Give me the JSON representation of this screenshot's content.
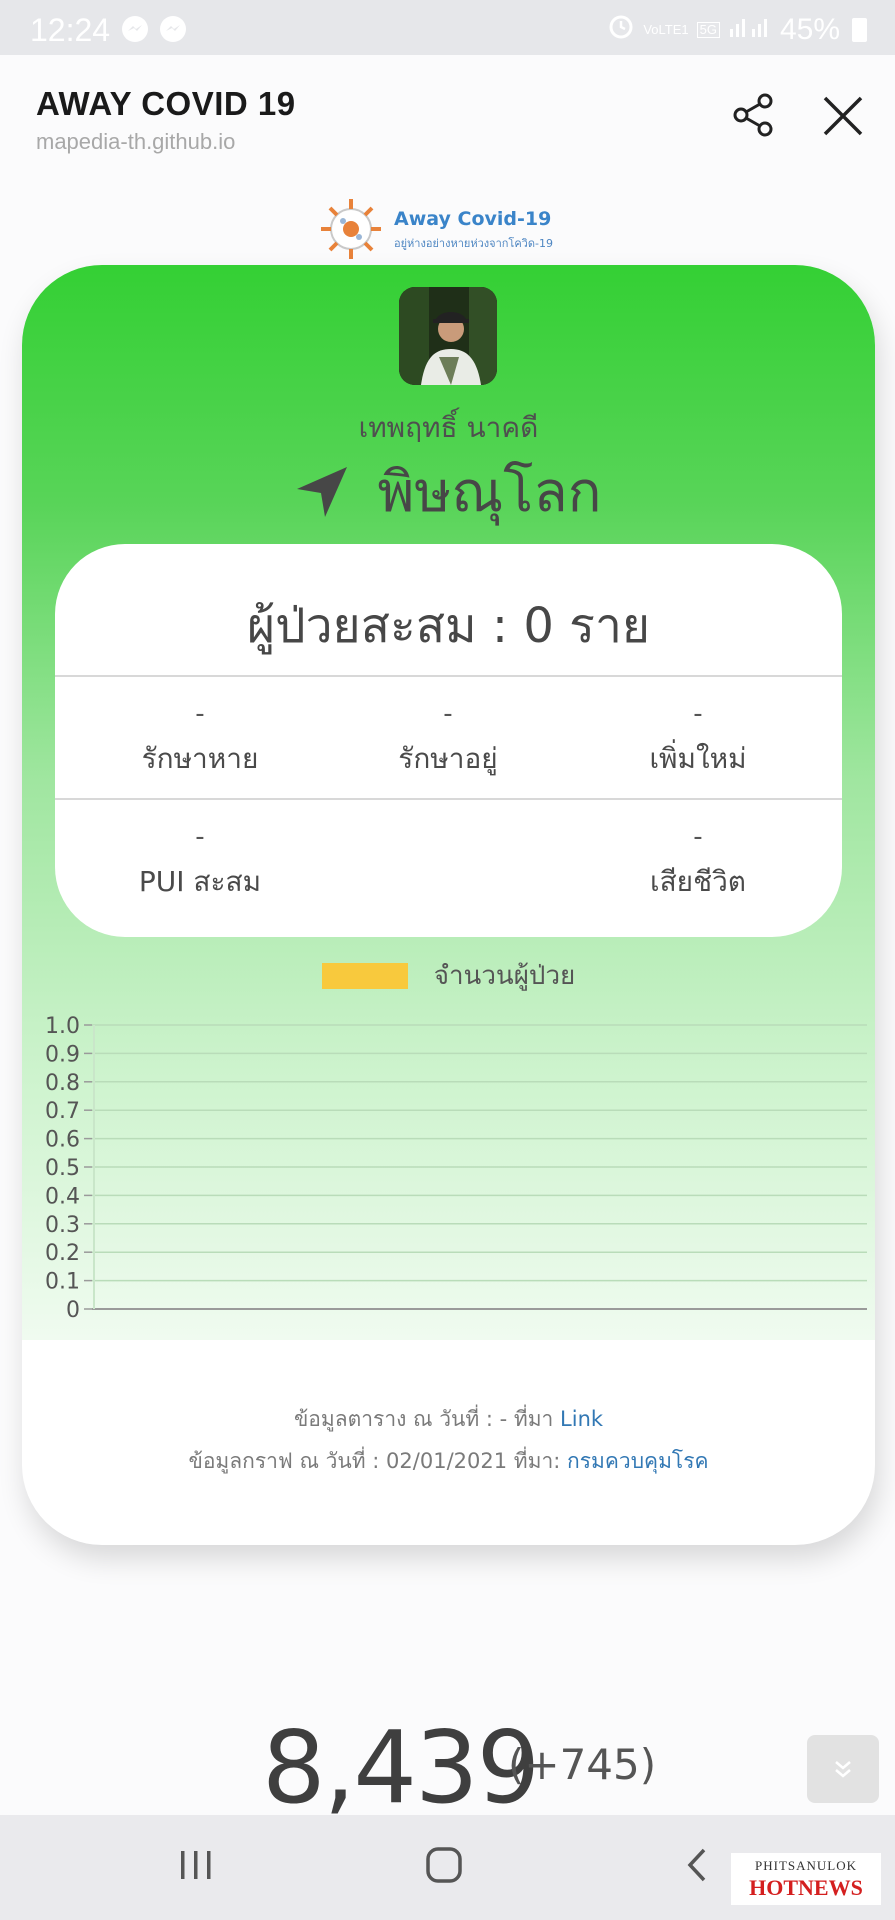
{
  "status_bar": {
    "time": "12:24",
    "network": "VoLTE1",
    "network_type": "5G",
    "battery": "45%",
    "icons": [
      "messenger-icon",
      "messenger-icon",
      "alarm-icon",
      "signal-icon",
      "battery-icon"
    ]
  },
  "header": {
    "title": "AWAY COVID 19",
    "url": "mapedia-th.github.io",
    "icons": [
      "share-icon",
      "close-icon"
    ]
  },
  "logo": {
    "title": "Away Covid-19",
    "subtitle": "อยู่ห่างอย่างหายห่วงจากโควิด-19"
  },
  "card": {
    "person_name": "เทพฤทธิ์ นาคดี",
    "province": "พิษณุโลก",
    "total_line": "ผู้ป่วยสะสม : 0 ราย",
    "stats": [
      {
        "value": "-",
        "label": "รักษาหาย"
      },
      {
        "value": "-",
        "label": "รักษาอยู่"
      },
      {
        "value": "-",
        "label": "เพิ่มใหม่"
      },
      {
        "value": "-",
        "label": "PUI สะสม"
      },
      {
        "value": "-",
        "label": "เสียชีวิต"
      }
    ],
    "colors": {
      "gradient_top": "#34d034",
      "legend_swatch": "#f8c93d",
      "link": "#3278b4"
    }
  },
  "chart_data": {
    "type": "bar",
    "categories": [],
    "series": [
      {
        "name": "จำนวนผู้ป่วย",
        "values": []
      }
    ],
    "title": "",
    "xlabel": "",
    "ylabel": "",
    "ylim": [
      0,
      1.0
    ],
    "yticks": [
      "1.0",
      "0.9",
      "0.8",
      "0.7",
      "0.6",
      "0.5",
      "0.4",
      "0.3",
      "0.2",
      "0.1",
      "0"
    ],
    "grid": true,
    "legend": "top-center"
  },
  "footnotes": {
    "table_prefix": "ข้อมูลตาราง ณ วันที่ : - ที่มา",
    "table_link": "Link",
    "graph_prefix": "ข้อมูลกราฟ ณ วันที่ : 02/01/2021 ที่มา:",
    "graph_link": "กรมควบคุมโรค"
  },
  "bottom": {
    "total": "8,439",
    "delta": "(+745)"
  },
  "watermark": {
    "top": "PHITSANULOK",
    "bottom": "HOTNEWS"
  }
}
